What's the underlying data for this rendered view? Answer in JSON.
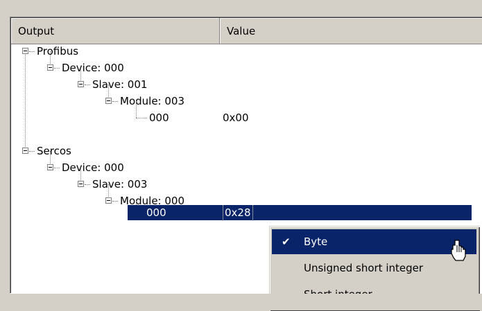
{
  "header": {
    "col_output": "Output",
    "col_value": "Value"
  },
  "tree": {
    "profibus": "Profibus",
    "profibus_device": "Device: 000",
    "profibus_slave": "Slave: 001",
    "profibus_module": "Module: 003",
    "profibus_item": "000",
    "profibus_item_value": "0x00",
    "sercos": "Sercos",
    "sercos_device": "Device: 000",
    "sercos_slave": "Slave: 003",
    "sercos_module": "Module: 000",
    "sercos_item": "000",
    "sercos_item_value": "0x28"
  },
  "context_menu": {
    "items": [
      {
        "label": "Byte",
        "checked": true,
        "icon": "checkmark-icon"
      },
      {
        "label": "Unsigned short integer",
        "checked": false
      },
      {
        "label": "Short integer",
        "checked": false
      }
    ]
  },
  "colors": {
    "selection": "#0a246a",
    "face": "#d4d0c8",
    "window": "#ffffff"
  }
}
